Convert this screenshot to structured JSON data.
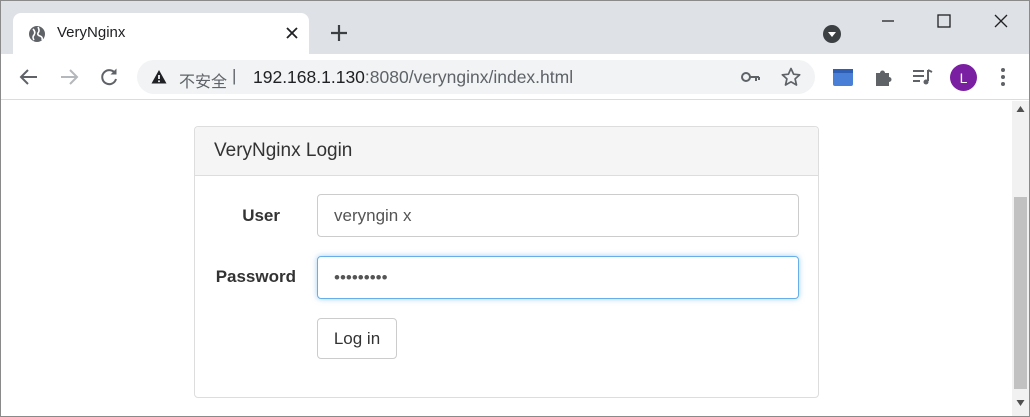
{
  "browser": {
    "tab": {
      "title": "VeryNginx",
      "favicon": "globe-icon"
    },
    "address": {
      "security_label": "不安全",
      "separator": "|",
      "host": "192.168.1.130",
      "path": ":8080/verynginx/index.html"
    },
    "profile_initial": "L",
    "colors": {
      "tabstrip": "#dee1e6",
      "avatar": "#7b1fa2",
      "extension_blue": "#4a7fd8"
    }
  },
  "login": {
    "heading": "VeryNginx Login",
    "user_label": "User",
    "user_value": "veryngin x",
    "password_label": "Password",
    "password_value": "•••••••••",
    "submit_label": "Log in",
    "focus_color": "#66afe9"
  }
}
